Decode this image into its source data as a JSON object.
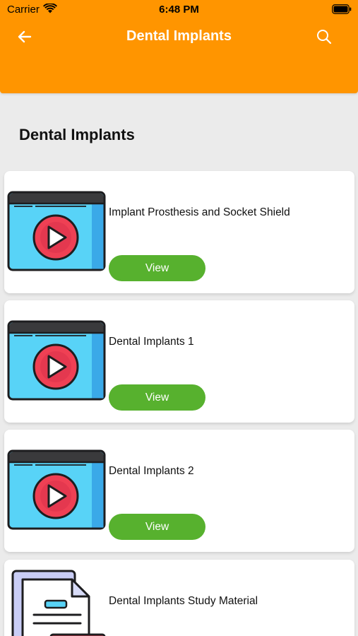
{
  "status_bar": {
    "carrier": "Carrier",
    "time": "6:48 PM"
  },
  "nav": {
    "title": "Dental Implants",
    "back_icon": "arrow-left-icon",
    "search_icon": "search-icon"
  },
  "section": {
    "title": "Dental Implants"
  },
  "items": [
    {
      "title": "Implant Prosthesis and Socket Shield",
      "button": "View",
      "icon": "video-player-icon"
    },
    {
      "title": "Dental Implants 1",
      "button": "View",
      "icon": "video-player-icon"
    },
    {
      "title": "Dental Implants 2",
      "button": "View",
      "icon": "video-player-icon"
    },
    {
      "title": "Dental Implants Study Material",
      "icon": "document-icon"
    }
  ],
  "colors": {
    "header": "#ff9500",
    "button": "#57b12e",
    "background": "#ebebeb"
  }
}
